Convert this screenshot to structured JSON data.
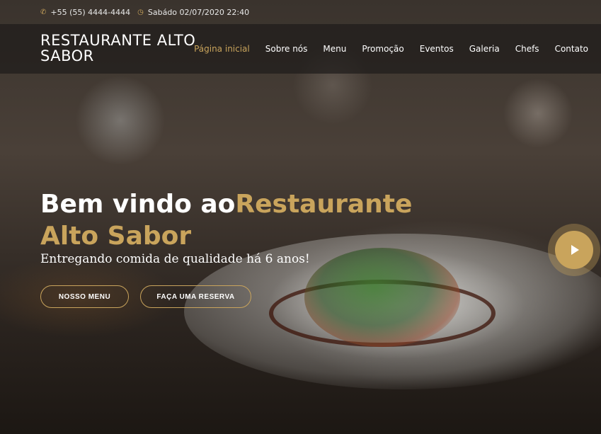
{
  "topbar": {
    "phone_icon": "phone-icon",
    "phone": "+55 (55) 4444-4444",
    "clock_icon": "clock-icon",
    "datetime": "Sabádo 02/07/2020 22:40"
  },
  "brand": {
    "name_line1": "RESTAURANTE ALTO",
    "name_line2": "SABOR"
  },
  "nav": {
    "items": [
      {
        "label": "Página inicial",
        "active": true
      },
      {
        "label": "Sobre nós"
      },
      {
        "label": "Menu"
      },
      {
        "label": "Promoção"
      },
      {
        "label": "Eventos"
      },
      {
        "label": "Galeria"
      },
      {
        "label": "Chefs"
      },
      {
        "label": "Contato"
      }
    ]
  },
  "hero": {
    "title_white": "Bem vindo ao",
    "title_gold": "Restaurante Alto Sabor",
    "subtitle": "Entregando comida de qualidade há 6 anos!",
    "btn_menu": "NOSSO MENU",
    "btn_reserva": "FAÇA UMA RESERVA",
    "play_icon": "play-icon"
  },
  "colors": {
    "accent": "#c9a45c",
    "nav_bg": "#1e1c1a"
  }
}
